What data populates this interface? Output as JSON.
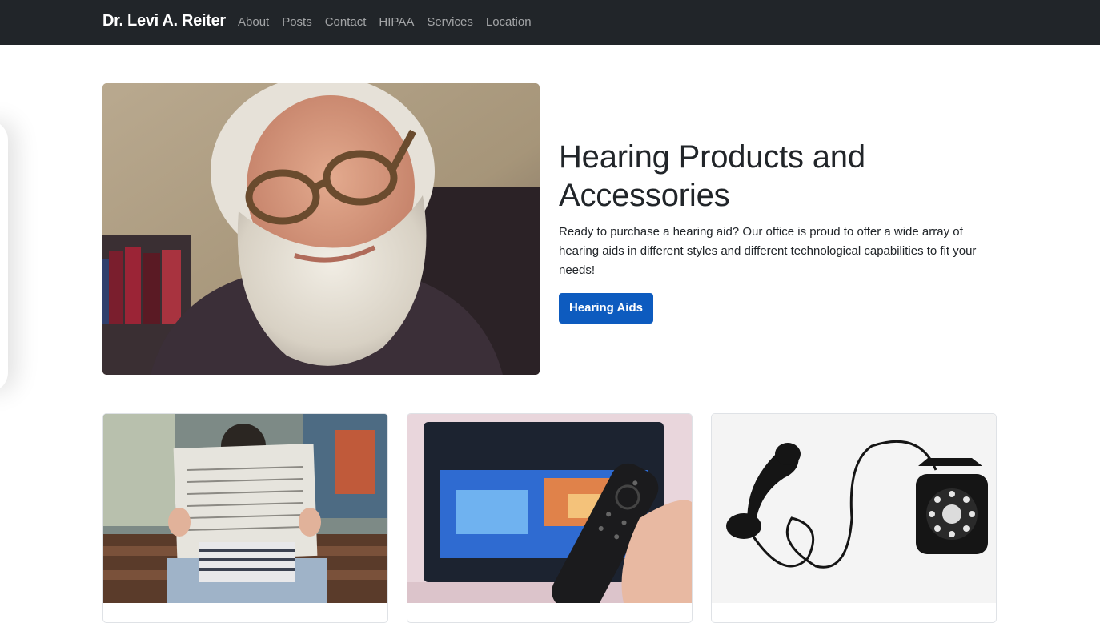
{
  "navbar": {
    "brand": "Dr. Levi A. Reiter",
    "links": [
      "About",
      "Posts",
      "Contact",
      "HIPAA",
      "Services",
      "Location"
    ]
  },
  "hero": {
    "title": "Hearing Products and Accessories",
    "description": "Ready to purchase a hearing aid? Our office is proud to offer a wide array of hearing aids in different styles and different technological capabilities to fit your needs!",
    "button_label": "Hearing Aids"
  },
  "colors": {
    "navbar_bg": "#212529",
    "accent": "#0d5bbf"
  }
}
